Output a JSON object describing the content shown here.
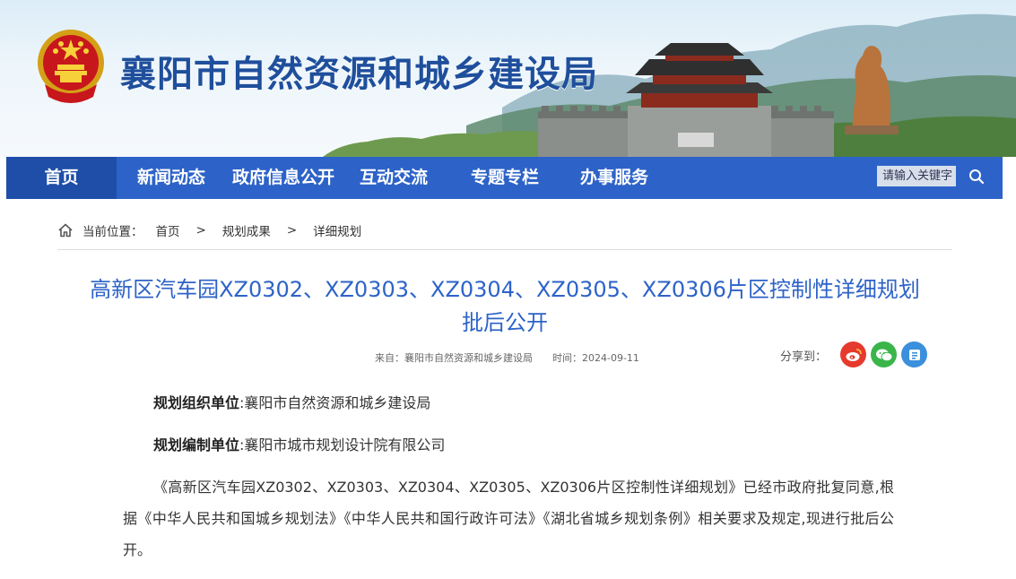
{
  "header": {
    "site_title": "襄阳市自然资源和城乡建设局",
    "gate_plaque": "丹汉阳"
  },
  "nav": {
    "items": [
      {
        "label": "首页",
        "active": true
      },
      {
        "label": "新闻动态"
      },
      {
        "label": "政府信息公开"
      },
      {
        "label": "互动交流"
      },
      {
        "label": "专题专栏"
      },
      {
        "label": "办事服务"
      }
    ],
    "search_placeholder": "请输入关键字"
  },
  "breadcrumb": {
    "label": "当前位置：",
    "items": [
      "首页",
      "规划成果",
      "详细规划"
    ],
    "separator": ">"
  },
  "article": {
    "title_line1": "高新区汽车园XZ0302、XZ0303、XZ0304、XZ0305、XZ0306片区控制性详细规划",
    "title_line2": "批后公开",
    "source_label": "来自：",
    "source": "襄阳市自然资源和城乡建设局",
    "time_label": "时间：",
    "time": "2024-09-11",
    "share_label": "分享到：",
    "org_label": "规划组织单位",
    "org_value": ":襄阳市自然资源和城乡建设局",
    "editor_label": "规划编制单位",
    "editor_value": ":襄阳市城市规划设计院有限公司",
    "body": "《高新区汽车园XZ0302、XZ0303、XZ0304、XZ0305、XZ0306片区控制性详细规划》已经市政府批复同意,根据《中华人民共和国城乡规划法》《中华人民共和国行政许可法》《湖北省城乡规划条例》相关要求及规定,现进行批后公开。"
  },
  "colors": {
    "nav_bg": "#2d63c8",
    "nav_active": "#1f4ea8",
    "title_blue": "#2d63c8",
    "site_title": "#1f4f9c",
    "weibo": "#e63a2e",
    "wechat": "#3bb54a",
    "qzone": "#3b8fdc"
  },
  "icons": [
    "national-emblem-icon",
    "home-icon",
    "search-icon",
    "weibo-icon",
    "wechat-icon",
    "qzone-icon"
  ]
}
